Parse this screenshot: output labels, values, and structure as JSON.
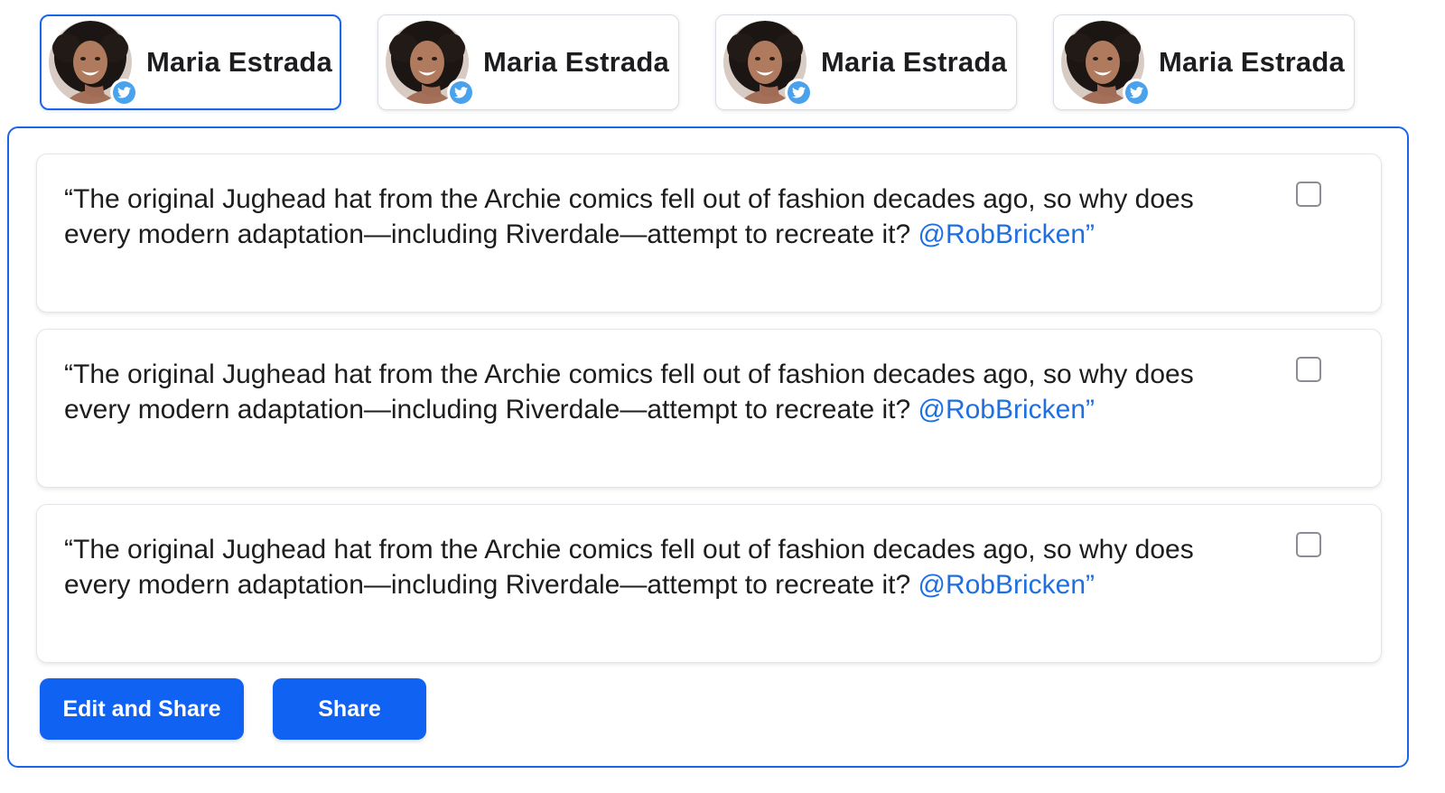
{
  "accounts": [
    {
      "name": "Maria Estrada",
      "network": "twitter",
      "selected": true
    },
    {
      "name": "Maria Estrada",
      "network": "twitter",
      "selected": false
    },
    {
      "name": "Maria Estrada",
      "network": "twitter",
      "selected": false
    },
    {
      "name": "Maria Estrada",
      "network": "twitter",
      "selected": false
    }
  ],
  "posts": [
    {
      "text": "“The original Jughead hat from the Archie comics fell out of fashion decades ago, so why does every modern adaptation—including Riverdale—attempt to recreate it? ",
      "mention": "@RobBricken”",
      "checked": false
    },
    {
      "text": "“The original Jughead hat from the Archie comics fell out of fashion decades ago, so why does every modern adaptation—including Riverdale—attempt to recreate it? ",
      "mention": "@RobBricken”",
      "checked": false
    },
    {
      "text": "“The original Jughead hat from the Archie comics fell out of fashion decades ago, so why does every modern adaptation—including Riverdale—attempt to recreate it? ",
      "mention": "@RobBricken”",
      "checked": false
    }
  ],
  "actions": {
    "edit_and_share_label": "Edit and Share",
    "share_label": "Share"
  },
  "colors": {
    "accent": "#1a66e6",
    "button": "#0f62f2",
    "mention": "#1f6fe0",
    "twitter": "#4aa1ec"
  },
  "icons": {
    "badge": "twitter-icon",
    "avatar": "profile-photo"
  }
}
